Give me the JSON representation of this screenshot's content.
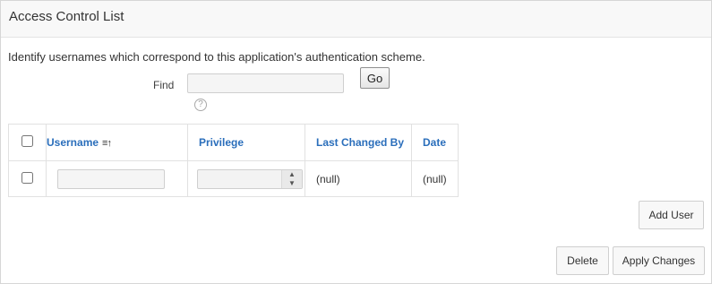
{
  "region": {
    "title": "Access Control List"
  },
  "intro": "Identify usernames which correspond to this application's authentication scheme.",
  "search": {
    "label": "Find",
    "value": "",
    "placeholder": "",
    "go_label": "Go",
    "help_glyph": "?"
  },
  "table": {
    "headers": {
      "username": "Username",
      "sort_glyph": "≡↑",
      "privilege": "Privilege",
      "last_changed_by": "Last Changed By",
      "date": "Date"
    },
    "rows": [
      {
        "username": "",
        "privilege": "",
        "last_changed_by": "(null)",
        "date": "(null)"
      }
    ]
  },
  "buttons": {
    "add_user": "Add User",
    "delete": "Delete",
    "apply_changes": "Apply Changes"
  },
  "colors": {
    "header_link": "#2a6ebb",
    "region_header_bg": "#f8f8f8",
    "border": "#d6d6d6"
  },
  "icons": {
    "sort": "sort-ascending-icon",
    "help": "help-icon",
    "select": "select-arrows-icon"
  }
}
